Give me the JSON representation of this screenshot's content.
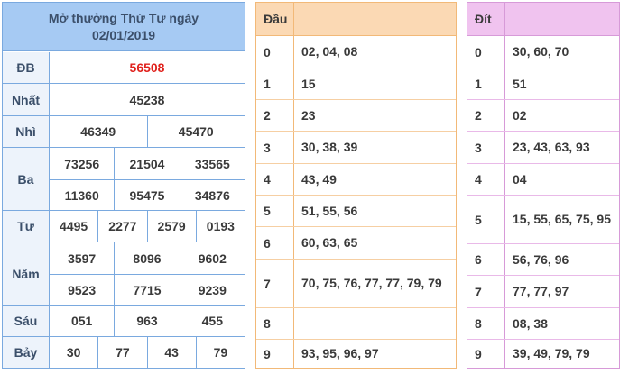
{
  "results": {
    "title_line1": "Mở thưởng Thứ Tư ngày",
    "title_line2": "02/01/2019",
    "prizes": [
      {
        "label": "ĐB",
        "values": [
          [
            "56508"
          ]
        ]
      },
      {
        "label": "Nhất",
        "values": [
          [
            "45238"
          ]
        ]
      },
      {
        "label": "Nhì",
        "values": [
          [
            "46349",
            "45470"
          ]
        ]
      },
      {
        "label": "Ba",
        "values": [
          [
            "73256",
            "21504",
            "33565"
          ],
          [
            "11360",
            "95475",
            "34876"
          ]
        ]
      },
      {
        "label": "Tư",
        "values": [
          [
            "4495",
            "2277",
            "2579",
            "0193"
          ]
        ]
      },
      {
        "label": "Năm",
        "values": [
          [
            "3597",
            "8096",
            "9602"
          ],
          [
            "9523",
            "7715",
            "9239"
          ]
        ]
      },
      {
        "label": "Sáu",
        "values": [
          [
            "051",
            "963",
            "455"
          ]
        ]
      },
      {
        "label": "Bảy",
        "values": [
          [
            "30",
            "77",
            "43",
            "79"
          ]
        ]
      }
    ],
    "special_color": "#e0201b"
  },
  "dau": {
    "header": "Đầu",
    "rows": [
      {
        "key": "0",
        "value": "02, 04, 08"
      },
      {
        "key": "1",
        "value": "15"
      },
      {
        "key": "2",
        "value": "23"
      },
      {
        "key": "3",
        "value": "30, 38, 39"
      },
      {
        "key": "4",
        "value": "43, 49"
      },
      {
        "key": "5",
        "value": "51, 55, 56"
      },
      {
        "key": "6",
        "value": "60, 63, 65"
      },
      {
        "key": "7",
        "value": "70, 75, 76, 77, 77, 79, 79"
      },
      {
        "key": "8",
        "value": ""
      },
      {
        "key": "9",
        "value": "93, 95, 96, 97"
      }
    ]
  },
  "dit": {
    "header": "Đít",
    "rows": [
      {
        "key": "0",
        "value": "30, 60, 70"
      },
      {
        "key": "1",
        "value": "51"
      },
      {
        "key": "2",
        "value": "02"
      },
      {
        "key": "3",
        "value": "23, 43, 63, 93"
      },
      {
        "key": "4",
        "value": "04"
      },
      {
        "key": "5",
        "value": "15, 55, 65, 75, 95"
      },
      {
        "key": "6",
        "value": "56, 76, 96"
      },
      {
        "key": "7",
        "value": "77, 77, 97"
      },
      {
        "key": "8",
        "value": "08, 38"
      },
      {
        "key": "9",
        "value": "39, 49, 79, 79"
      }
    ]
  }
}
